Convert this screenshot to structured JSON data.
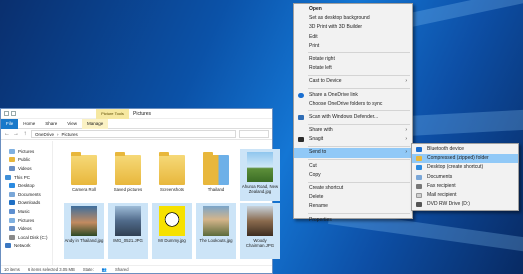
{
  "desktop_colors": {
    "bg": "#0b52a8"
  },
  "explorer": {
    "ribbon_context_label": "Picture Tools",
    "title": "Pictures",
    "tabs": [
      "File",
      "Home",
      "Share",
      "View",
      "Manage"
    ],
    "breadcrumb": [
      "OneDrive",
      "Pictures"
    ],
    "nav_tree": [
      {
        "label": "Pictures",
        "icon": "pictures-icon"
      },
      {
        "label": "Public",
        "icon": "folder-icon"
      },
      {
        "label": "Videos",
        "icon": "videos-icon"
      },
      {
        "label": "This PC",
        "icon": "computer-icon"
      },
      {
        "label": "Desktop",
        "icon": "desktop-icon"
      },
      {
        "label": "Documents",
        "icon": "documents-icon"
      },
      {
        "label": "Downloads",
        "icon": "downloads-icon"
      },
      {
        "label": "Music",
        "icon": "music-icon"
      },
      {
        "label": "Pictures",
        "icon": "pictures-icon"
      },
      {
        "label": "Videos",
        "icon": "videos-icon"
      },
      {
        "label": "Local Disk (C:)",
        "icon": "drive-icon"
      },
      {
        "label": "Network",
        "icon": "network-icon"
      }
    ],
    "items": [
      {
        "label": "Camera Roll",
        "kind": "folder"
      },
      {
        "label": "Saved pictures",
        "kind": "folder"
      },
      {
        "label": "Screenshots",
        "kind": "folder"
      },
      {
        "label": "Thailand",
        "kind": "folder"
      },
      {
        "label": "Ahuroa Road, New Zealand.jpg",
        "kind": "photo"
      },
      {
        "label": "Andy in Thailand.jpg",
        "kind": "photo"
      },
      {
        "label": "IMG_0521.JPG",
        "kind": "photo"
      },
      {
        "label": "Mr Dummy.jpg",
        "kind": "photo"
      },
      {
        "label": "The Lookouts.jpg",
        "kind": "photo"
      },
      {
        "label": "Woody Chairman.JPG",
        "kind": "photo"
      }
    ],
    "status": {
      "count": "10 items",
      "selected": "6 items selected  3.05 MB",
      "sharing_label": "State:",
      "sharing_value": "Shared"
    }
  },
  "context_menu": {
    "groups": [
      [
        {
          "label": "Open",
          "bold": true
        },
        {
          "label": "Set as desktop background"
        },
        {
          "label": "3D Print with 3D Builder"
        },
        {
          "label": "Edit"
        },
        {
          "label": "Print"
        }
      ],
      [
        {
          "label": "Rotate right"
        },
        {
          "label": "Rotate left"
        }
      ],
      [
        {
          "label": "Cast to Device",
          "submenu": true
        }
      ],
      [
        {
          "label": "Share a OneDrive link",
          "icon": "onedrive-icon"
        },
        {
          "label": "Choose OneDrive folders to sync"
        }
      ],
      [
        {
          "label": "Scan with Windows Defender...",
          "icon": "defender-icon"
        }
      ],
      [
        {
          "label": "Share with",
          "submenu": true
        },
        {
          "label": "Snagit",
          "submenu": true,
          "icon": "snagit-icon"
        }
      ],
      [
        {
          "label": "Send to",
          "submenu": true,
          "highlight": true
        }
      ],
      [
        {
          "label": "Cut"
        },
        {
          "label": "Copy"
        }
      ],
      [
        {
          "label": "Create shortcut"
        },
        {
          "label": "Delete"
        },
        {
          "label": "Rename"
        }
      ],
      [
        {
          "label": "Properties"
        }
      ]
    ]
  },
  "send_to_menu": {
    "items": [
      {
        "label": "Bluetooth device",
        "icon": "bluetooth-icon",
        "color": "#1a6fd1"
      },
      {
        "label": "Compressed (zipped) folder",
        "icon": "zip-folder-icon",
        "color": "#e8b73c",
        "highlight": true
      },
      {
        "label": "Desktop (create shortcut)",
        "icon": "desktop-icon",
        "color": "#2a8ae0"
      },
      {
        "label": "Documents",
        "icon": "documents-icon",
        "color": "#7aa7d8"
      },
      {
        "label": "Fax recipient",
        "icon": "fax-icon",
        "color": "#777777"
      },
      {
        "label": "Mail recipient",
        "icon": "mail-icon",
        "color": "#cfcfcf"
      },
      {
        "label": "DVD RW Drive (D:)",
        "icon": "dvd-drive-icon",
        "color": "#555555"
      }
    ]
  }
}
